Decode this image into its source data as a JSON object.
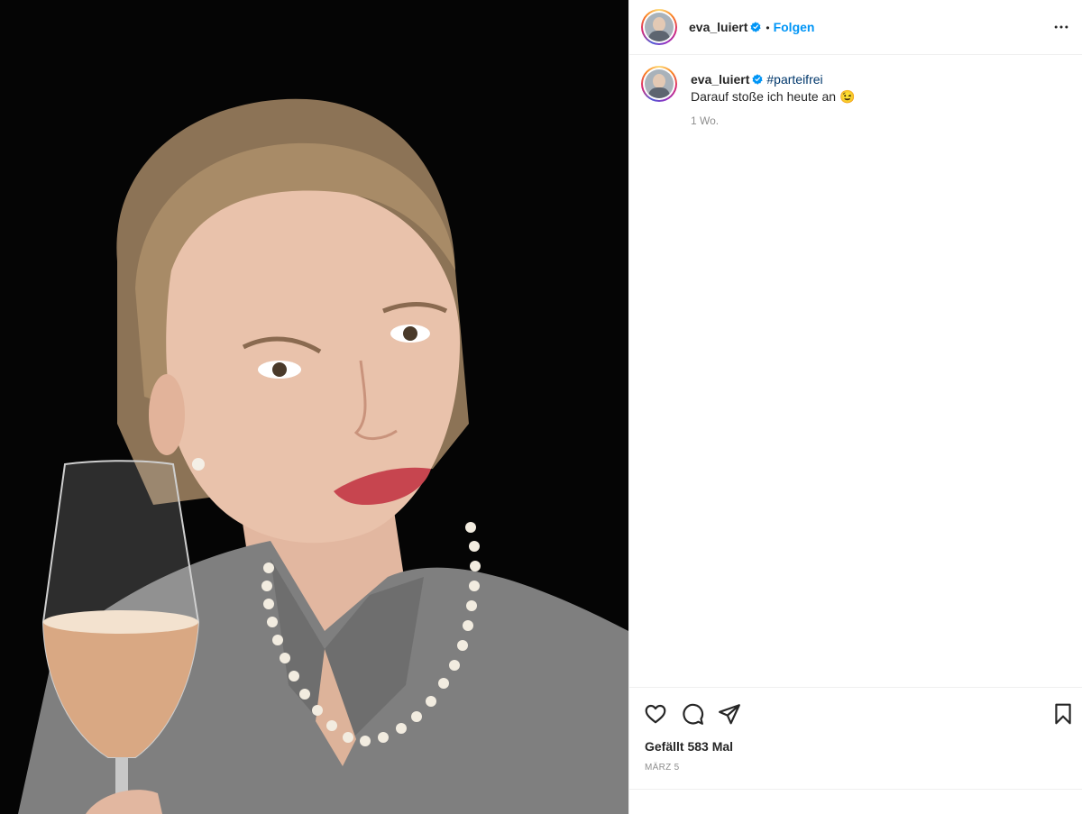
{
  "post": {
    "image_alt": "Portrait photo of a smiling woman with blonde hair and a pearl necklace raising a glass of sparkling wine against a black background"
  },
  "header": {
    "username": "eva_luiert",
    "separator": "•",
    "follow_label": "Folgen"
  },
  "caption": {
    "username": "eva_luiert",
    "hashtag": "#parteifrei",
    "text": "Darauf stoße ich heute an 😉",
    "time": "1 Wo."
  },
  "engagement": {
    "likes_text": "Gefällt 583 Mal",
    "date": "MÄRZ 5"
  },
  "colors": {
    "accent": "#0095f6",
    "verified": "#0095f6",
    "hashtag": "#00376b",
    "muted": "#8e8e8e"
  }
}
